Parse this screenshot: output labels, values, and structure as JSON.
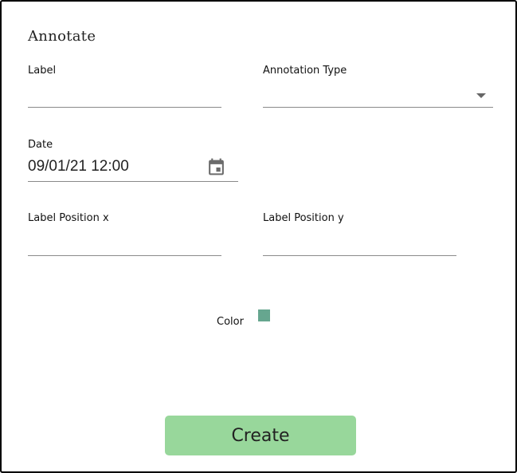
{
  "dialog": {
    "title": "Annotate"
  },
  "fields": {
    "label": {
      "label": "Label",
      "value": ""
    },
    "annotation_type": {
      "label": "Annotation Type",
      "selected": ""
    },
    "date": {
      "label": "Date",
      "value": "09/01/21 12:00",
      "icon": "calendar-icon"
    },
    "label_position_x": {
      "label": "Label Position x",
      "value": ""
    },
    "label_position_y": {
      "label": "Label Position y",
      "value": ""
    }
  },
  "color": {
    "label": "Color",
    "value": "#66a68f"
  },
  "actions": {
    "create_label": "Create",
    "create_color": "#98d79b"
  }
}
